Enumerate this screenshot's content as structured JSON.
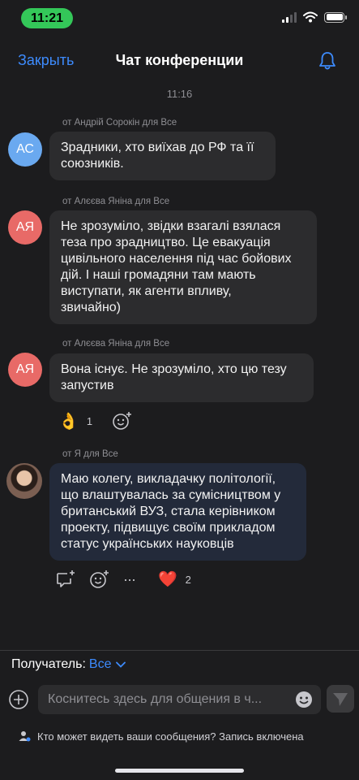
{
  "status_bar": {
    "time": "11:21"
  },
  "nav": {
    "close": "Закрыть",
    "title": "Чат конференции"
  },
  "time_separator": "11:16",
  "messages": [
    {
      "meta": "от Андрій Сорокін для Все",
      "initials": "АС",
      "avatar_color": "#6aa9f0",
      "lines": [
        "Зрадники, хто виїхав до РФ та її",
        "союзників."
      ]
    },
    {
      "meta": "от Алєєва Яніна для Все",
      "initials": "АЯ",
      "avatar_color": "#e86a67",
      "lines": [
        "Не зрозуміло, звідки взагалі взялася",
        "теза про зрадництво. Це евакуація",
        "цивільного населення під час бойових",
        "дій. І наші громадяни там мають",
        "виступати, як агенти впливу,",
        "звичайно)"
      ]
    },
    {
      "meta": "от Алєєва Яніна для Все",
      "initials": "АЯ",
      "avatar_color": "#e86a67",
      "lines": [
        "Вона існує. Не зрозуміло, хто цю тезу",
        "запустив"
      ],
      "reaction": {
        "emoji": "👌",
        "count": "1"
      }
    },
    {
      "meta": "от Я для Все",
      "lines": [
        "Маю колегу, викладачку політології,",
        "що влаштувалась за сумісництвом у",
        "британський ВУЗ, стала керівником",
        "проекту, підвищує своїм прикладом",
        "статус українських науковців"
      ],
      "more": "···",
      "reaction": {
        "emoji": "❤️",
        "count": "2"
      }
    }
  ],
  "composer": {
    "recipient_label": "Получатель:",
    "recipient_value": "Все",
    "placeholder": "Коснитесь здесь для общения в ч...",
    "privacy_text": "Кто может видеть ваши сообщения? Запись включена"
  },
  "colors": {
    "accent": "#3d8bfd",
    "background": "#1c1c1e",
    "bubble": "#2c2c2e"
  }
}
